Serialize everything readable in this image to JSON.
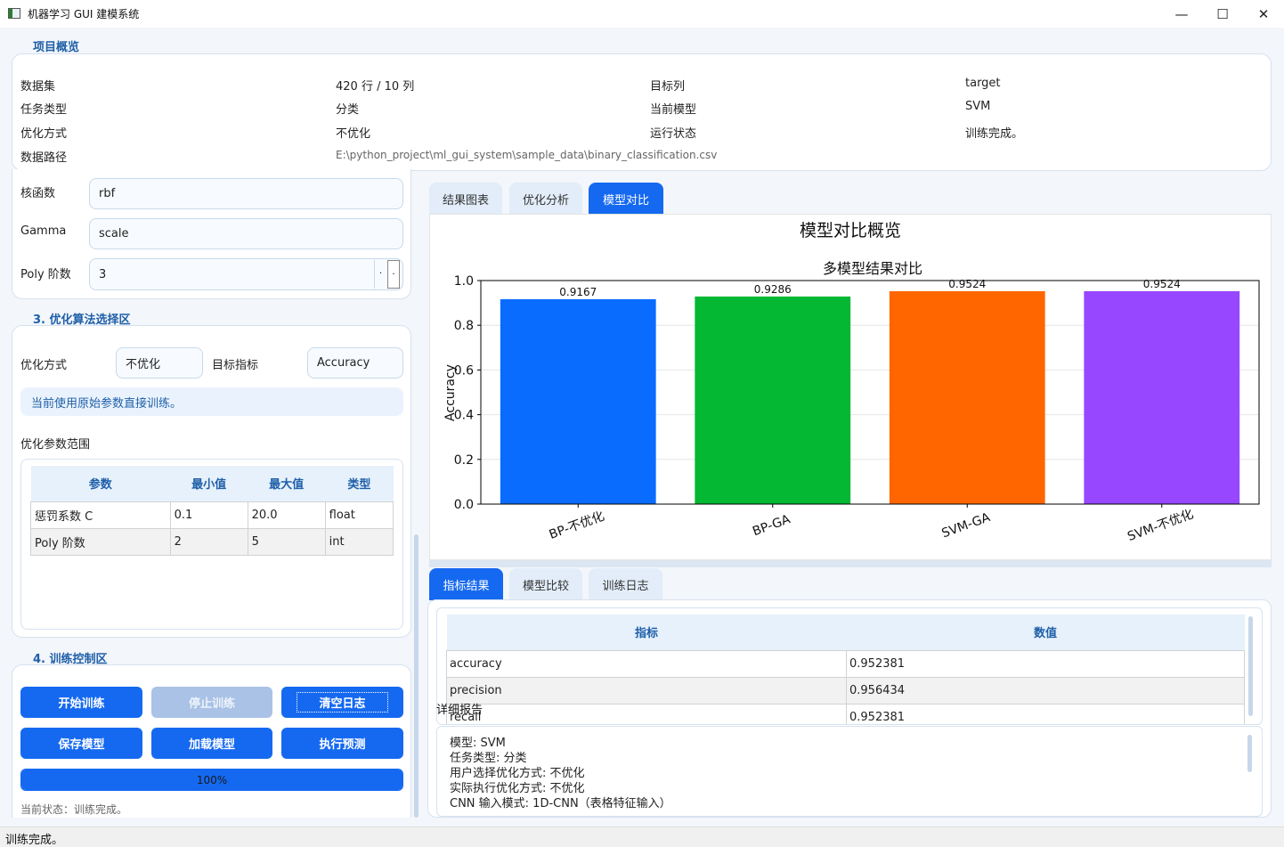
{
  "window": {
    "title": "机器学习 GUI 建模系统",
    "minimize": "—",
    "maximize": "☐",
    "close": "✕"
  },
  "overview": {
    "title": "项目概览",
    "rows": [
      {
        "k1": "数据集",
        "v1": "420 行 / 10 列",
        "k2": "目标列",
        "v2": "target"
      },
      {
        "k1": "任务类型",
        "v1": "分类",
        "k2": "当前模型",
        "v2": "SVM"
      },
      {
        "k1": "优化方式",
        "v1": "不优化",
        "k2": "运行状态",
        "v2": "训练完成。"
      },
      {
        "k1": "数据路径",
        "v1": "E:\\python_project\\ml_gui_system\\sample_data\\binary_classification.csv",
        "k2": "",
        "v2": ""
      }
    ]
  },
  "params": {
    "kernel_label": "核函数",
    "kernel_value": "rbf",
    "gamma_label": "Gamma",
    "gamma_value": "scale",
    "poly_label": "Poly 阶数",
    "poly_value": "3",
    "spin_up": "·",
    "spin_down": "·"
  },
  "optimization": {
    "title": "3. 优化算法选择区",
    "method_label": "优化方式",
    "method_value": "不优化",
    "metric_label": "目标指标",
    "metric_value": "Accuracy",
    "hint": "当前使用原始参数直接训练。",
    "range_label": "优化参数范围",
    "table_headers": [
      "参数",
      "最小值",
      "最大值",
      "类型"
    ],
    "table_rows": [
      [
        "惩罚系数 C",
        "0.1",
        "20.0",
        "float"
      ],
      [
        "Poly 阶数",
        "2",
        "5",
        "int"
      ]
    ]
  },
  "training": {
    "title": "4. 训练控制区",
    "start": "开始训练",
    "stop": "停止训练",
    "clear": "清空日志",
    "save": "保存模型",
    "load": "加载模型",
    "predict": "执行预测",
    "progress": "100%",
    "progress_value": 1.0,
    "status": "当前状态：训练完成。"
  },
  "top_tabs": [
    "结果图表",
    "优化分析",
    "模型对比"
  ],
  "top_tab_active": 2,
  "bottom_tabs": [
    "指标结果",
    "模型比较",
    "训练日志"
  ],
  "bottom_tab_active": 0,
  "chart_data": {
    "type": "bar",
    "suptitle": "模型对比概览",
    "title": "多模型结果对比",
    "categories": [
      "BP-不优化",
      "BP-GA",
      "SVM-GA",
      "SVM-不优化"
    ],
    "values": [
      0.9167,
      0.9286,
      0.9524,
      0.9524
    ],
    "value_labels": [
      "0.9167",
      "0.9286",
      "0.9524",
      "0.9524"
    ],
    "colors": [
      "#0a6cff",
      "#05b833",
      "#ff6600",
      "#9747ff"
    ],
    "xlabel": "",
    "ylabel": "Accuracy",
    "ylim": [
      0,
      1.0
    ],
    "yticks": [
      "0.0",
      "0.2",
      "0.4",
      "0.6",
      "0.8",
      "1.0"
    ],
    "grid": true
  },
  "metrics": {
    "headers": [
      "指标",
      "数值"
    ],
    "rows": [
      [
        "accuracy",
        "0.952381"
      ],
      [
        "precision",
        "0.956434"
      ],
      [
        "recall",
        "0.952381"
      ]
    ]
  },
  "report": {
    "label": "详细报告",
    "lines": [
      "模型: SVM",
      "任务类型: 分类",
      "用户选择优化方式: 不优化",
      "实际执行优化方式: 不优化",
      "CNN 输入模式: 1D-CNN（表格特征输入）"
    ]
  },
  "statusbar": "训练完成。"
}
